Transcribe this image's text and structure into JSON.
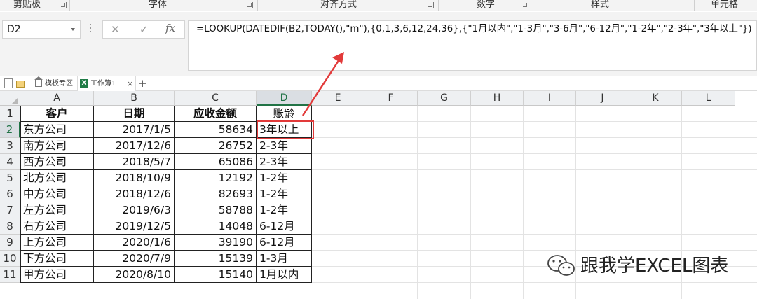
{
  "ribbon": {
    "groups": [
      "剪贴板",
      "字体",
      "对齐方式",
      "数字",
      "样式",
      "单元格"
    ]
  },
  "formula_bar": {
    "name_box": "D2",
    "fx_label": "fx",
    "formula": "=LOOKUP(DATEDIF(B2,TODAY(),\"m\"),{0,1,3,6,12,24,36},{\"1月以内\",\"1-3月\",\"3-6月\",\"6-12月\",\"1-2年\",\"2-3年\",\"3年以上\"})"
  },
  "tabs": {
    "template_tab": "模板专区",
    "workbook_tab": "工作簿1",
    "close_glyph": "×",
    "add_glyph": "+"
  },
  "sheet": {
    "columns": [
      "A",
      "B",
      "C",
      "D",
      "E",
      "F",
      "G",
      "H",
      "I",
      "J",
      "K",
      "L"
    ],
    "selected_column": "D",
    "selected_row": "2",
    "rows": [
      "1",
      "2",
      "3",
      "4",
      "5",
      "6",
      "7",
      "8",
      "9",
      "10",
      "11"
    ],
    "headers": {
      "customer": "客户",
      "date": "日期",
      "amount": "应收金额",
      "aging": "账龄"
    },
    "data": [
      {
        "customer": "东方公司",
        "date": "2017/1/5",
        "amount": "58634",
        "aging": "3年以上"
      },
      {
        "customer": "南方公司",
        "date": "2017/12/6",
        "amount": "26752",
        "aging": "2-3年"
      },
      {
        "customer": "西方公司",
        "date": "2018/5/7",
        "amount": "65086",
        "aging": "2-3年"
      },
      {
        "customer": "北方公司",
        "date": "2018/10/9",
        "amount": "12192",
        "aging": "1-2年"
      },
      {
        "customer": "中方公司",
        "date": "2018/12/6",
        "amount": "82693",
        "aging": "1-2年"
      },
      {
        "customer": "左方公司",
        "date": "2019/6/3",
        "amount": "58788",
        "aging": "1-2年"
      },
      {
        "customer": "右方公司",
        "date": "2019/12/5",
        "amount": "14048",
        "aging": "6-12月"
      },
      {
        "customer": "上方公司",
        "date": "2020/1/6",
        "amount": "39190",
        "aging": "6-12月"
      },
      {
        "customer": "下方公司",
        "date": "2020/7/9",
        "amount": "15139",
        "aging": "1-3月"
      },
      {
        "customer": "甲方公司",
        "date": "2020/8/10",
        "amount": "15140",
        "aging": "1月以内"
      }
    ]
  },
  "watermark": {
    "text": "跟我学EXCEL图表"
  },
  "colors": {
    "selection_border": "#e23a3a",
    "arrow": "#e23a3a",
    "excel_green": "#217346"
  }
}
